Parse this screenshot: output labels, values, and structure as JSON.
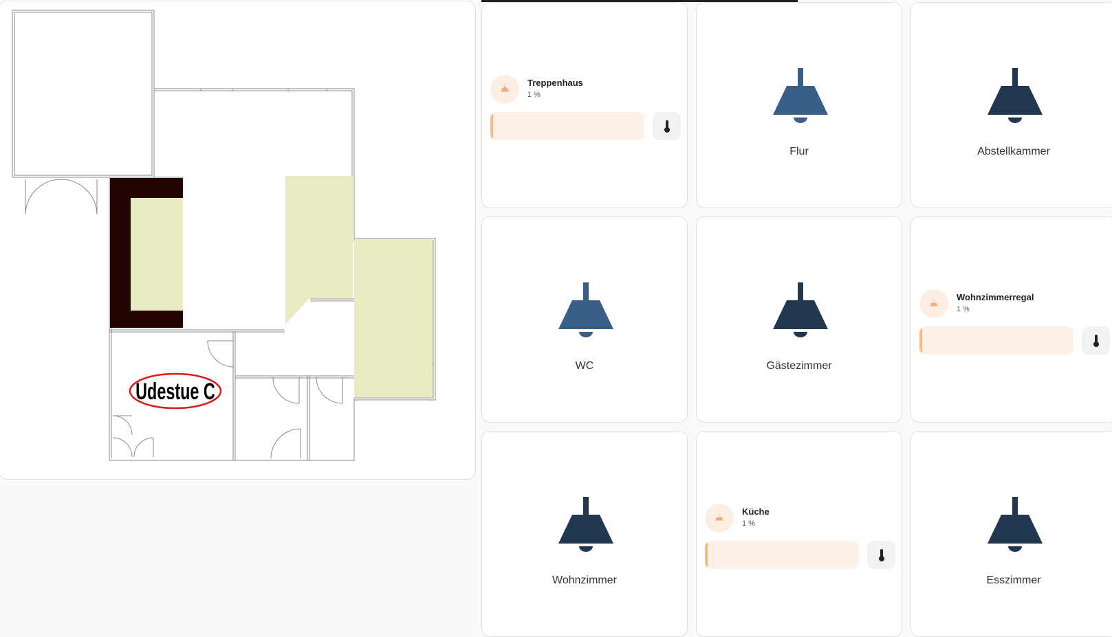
{
  "floorplan": {
    "room_label": "Udestue C",
    "colors": {
      "wall": "#888888",
      "highlight": "#eaecc3",
      "dark": "#250404",
      "label_outline": "#e01818"
    }
  },
  "tiles": [
    {
      "type": "light",
      "name": "Treppenhaus",
      "state": "1 %",
      "brightness_fraction": 0.01
    },
    {
      "type": "lamp",
      "name": "Flur",
      "icon": "ceiling-lamp-icon",
      "color": "#3a5f86"
    },
    {
      "type": "lamp",
      "name": "Abstellkammer",
      "icon": "ceiling-lamp-icon",
      "color": "#21374f"
    },
    {
      "type": "lamp",
      "name": "WC",
      "icon": "ceiling-lamp-icon",
      "color": "#3a5f86"
    },
    {
      "type": "lamp",
      "name": "Gästezimmer",
      "icon": "ceiling-lamp-icon",
      "color": "#21374f"
    },
    {
      "type": "light",
      "name": "Wohnzimmerregal",
      "state": "1 %",
      "brightness_fraction": 0.01
    },
    {
      "type": "lamp",
      "name": "Wohnzimmer",
      "icon": "ceiling-lamp-icon",
      "color": "#21374f"
    },
    {
      "type": "light",
      "name": "Küche",
      "state": "1 %",
      "brightness_fraction": 0.01
    },
    {
      "type": "lamp",
      "name": "Esszimmer",
      "icon": "ceiling-lamp-icon",
      "color": "#21374f"
    }
  ],
  "icons": {
    "light_bulb": "bulb-icon",
    "temperature": "thermometer-icon"
  },
  "colors": {
    "light_accent": "#f6b98a",
    "light_bg": "#fdf0e6"
  }
}
